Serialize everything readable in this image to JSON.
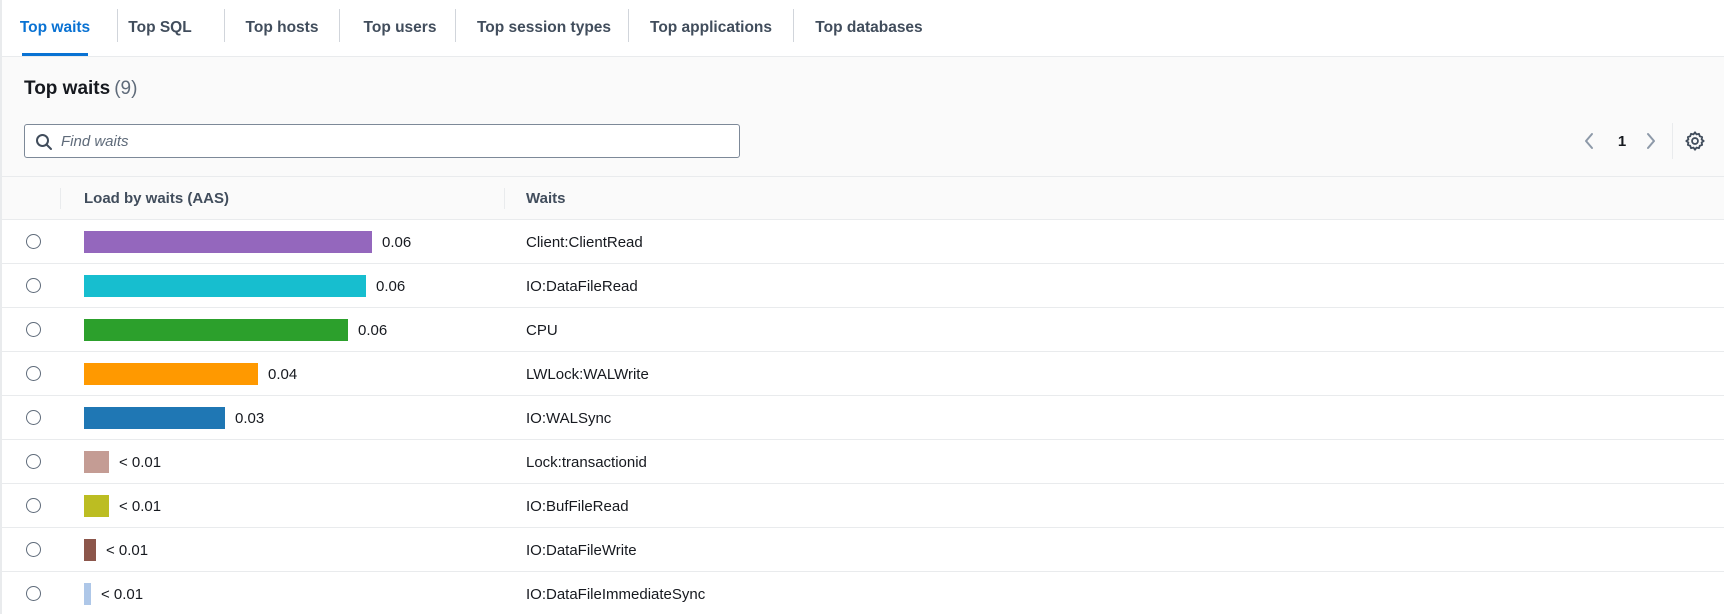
{
  "tabs": [
    {
      "label": "Top waits",
      "active": true
    },
    {
      "label": "Top SQL",
      "active": false
    },
    {
      "label": "Top hosts",
      "active": false
    },
    {
      "label": "Top users",
      "active": false
    },
    {
      "label": "Top session types",
      "active": false
    },
    {
      "label": "Top applications",
      "active": false
    },
    {
      "label": "Top databases",
      "active": false
    }
  ],
  "panel": {
    "title": "Top waits",
    "count": "(9)",
    "search_placeholder": "Find waits",
    "search_value": "",
    "page": "1"
  },
  "table": {
    "columns": [
      "Load by waits (AAS)",
      "Waits"
    ],
    "rows": [
      {
        "load_label": "0.06",
        "load_fraction": 0.96,
        "color": "#9467bd",
        "wait": "Client:ClientRead"
      },
      {
        "load_label": "0.06",
        "load_fraction": 0.94,
        "color": "#17becf",
        "wait": "IO:DataFileRead"
      },
      {
        "load_label": "0.06",
        "load_fraction": 0.88,
        "color": "#2ca02c",
        "wait": "CPU"
      },
      {
        "load_label": "0.04",
        "load_fraction": 0.58,
        "color": "#ff9900",
        "wait": "LWLock:WALWrite"
      },
      {
        "load_label": "0.03",
        "load_fraction": 0.47,
        "color": "#1f77b4",
        "wait": "IO:WALSync"
      },
      {
        "load_label": "< 0.01",
        "load_fraction": 0.084,
        "color": "#c49c94",
        "wait": "Lock:transactionid"
      },
      {
        "load_label": "< 0.01",
        "load_fraction": 0.084,
        "color": "#bcbd22",
        "wait": "IO:BufFileRead"
      },
      {
        "load_label": "< 0.01",
        "load_fraction": 0.04,
        "color": "#8c564b",
        "wait": "IO:DataFileWrite"
      },
      {
        "load_label": "< 0.01",
        "load_fraction": 0.022,
        "color": "#aec7e8",
        "wait": "IO:DataFileImmediateSync"
      }
    ]
  }
}
